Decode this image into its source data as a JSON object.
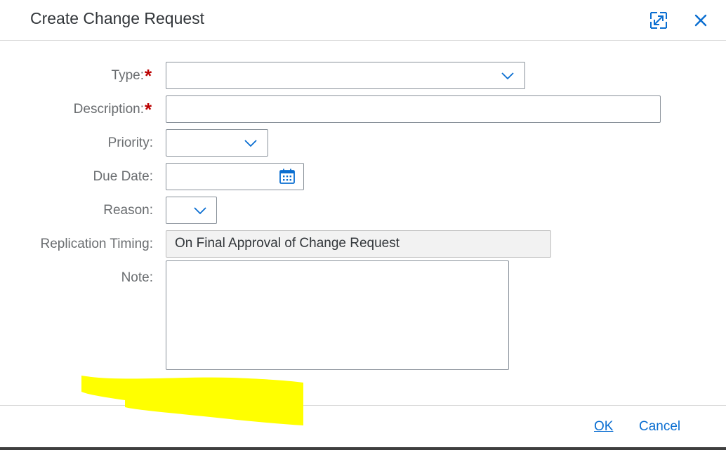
{
  "dialog": {
    "title": "Create Change Request",
    "maximize_icon": "maximize-icon",
    "close_icon": "close-icon"
  },
  "form": {
    "type": {
      "label": "Type:",
      "required_mark": "*",
      "value": ""
    },
    "description": {
      "label": "Description:",
      "required_mark": "*",
      "value": ""
    },
    "priority": {
      "label": "Priority:",
      "value": ""
    },
    "due_date": {
      "label": "Due Date:",
      "value": "",
      "icon": "calendar-icon"
    },
    "reason": {
      "label": "Reason:",
      "value": ""
    },
    "replication_timing": {
      "label": "Replication Timing:",
      "value": "On Final Approval of Change Request"
    },
    "note": {
      "label": "Note:",
      "value": ""
    }
  },
  "footer": {
    "ok_label": "OK",
    "cancel_label": "Cancel"
  },
  "colors": {
    "accent": "#0a6ed1",
    "required": "#bb0000",
    "highlight": "#ffff00"
  }
}
